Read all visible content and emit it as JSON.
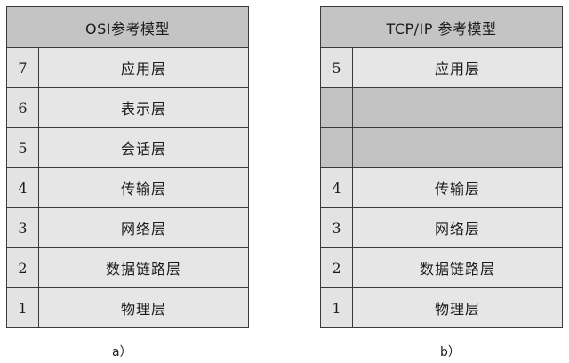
{
  "model_a": {
    "title": "OSI参考模型",
    "layers": [
      {
        "num": "7",
        "name": "应用层"
      },
      {
        "num": "6",
        "name": "表示层"
      },
      {
        "num": "5",
        "name": "会话层"
      },
      {
        "num": "4",
        "name": "传输层"
      },
      {
        "num": "3",
        "name": "网络层"
      },
      {
        "num": "2",
        "name": "数据链路层"
      },
      {
        "num": "1",
        "name": "物理层"
      }
    ],
    "caption": "a）"
  },
  "model_b": {
    "title": "TCP/IP 参考模型",
    "layers": [
      {
        "num": "5",
        "name": "应用层"
      },
      {
        "num": "",
        "name": ""
      },
      {
        "num": "",
        "name": ""
      },
      {
        "num": "4",
        "name": "传输层"
      },
      {
        "num": "3",
        "name": "网络层"
      },
      {
        "num": "2",
        "name": "数据链路层"
      },
      {
        "num": "1",
        "name": "物理层"
      }
    ],
    "caption": "b）"
  },
  "colors": {
    "header_bg": "#c4c4c4",
    "row_bg": "#e6e6e6",
    "empty_bg": "#c2c2c2",
    "border": "#3a3a3a"
  }
}
